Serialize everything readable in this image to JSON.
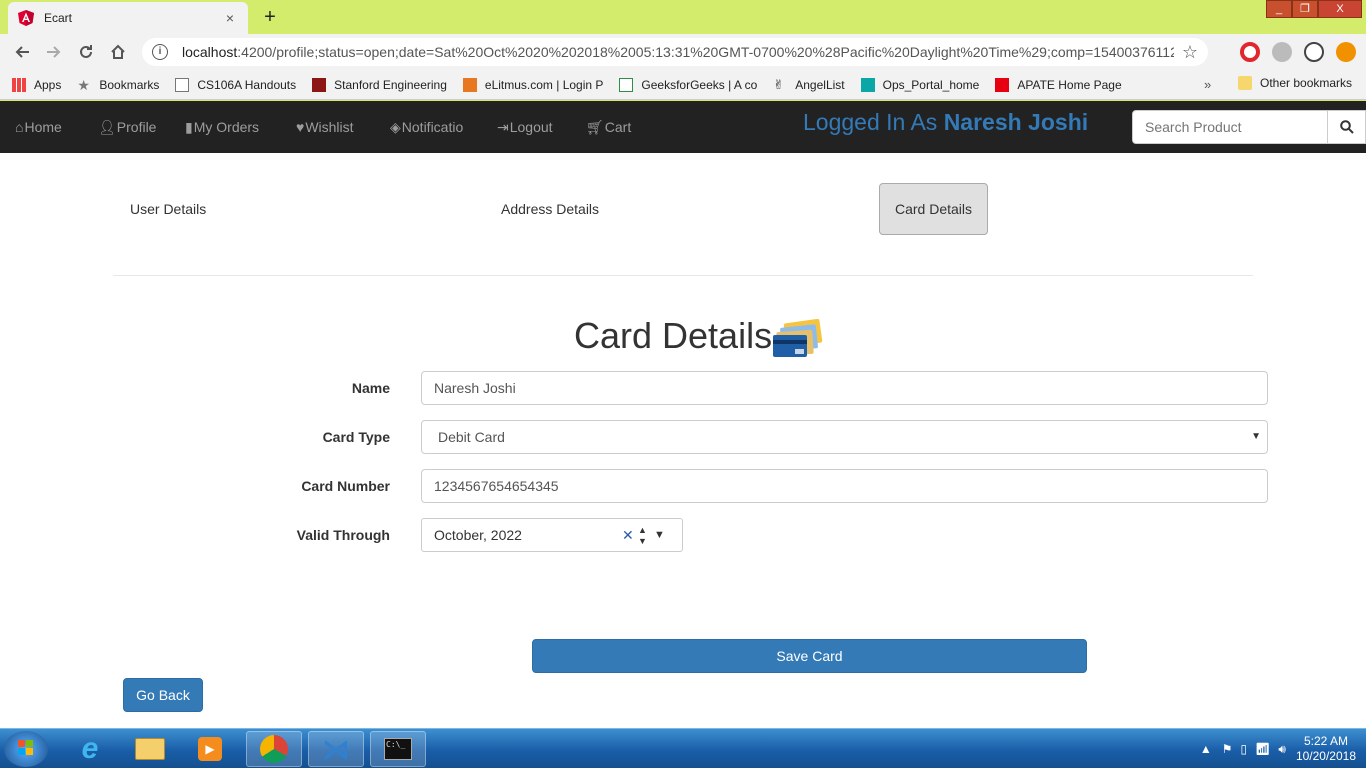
{
  "browser": {
    "tab_title": "Ecart",
    "tab_close": "×",
    "new_tab": "+",
    "url_host": "localhost",
    "url_rest": ":4200/profile;status=open;date=Sat%20Oct%2020%202018%2005:13:31%20GMT-0700%20%28Pacific%20Daylight%20Time%29;comp=154003761126...",
    "window_buttons": [
      "_",
      "❐",
      "X"
    ]
  },
  "bookmarks": {
    "items": [
      "Apps",
      "Bookmarks",
      "CS106A Handouts",
      "Stanford Engineering",
      "eLitmus.com | Login P",
      "GeeksforGeeks | A co",
      "AngelList",
      "Ops_Portal_home",
      "APATE Home Page"
    ],
    "more": "»",
    "other": "Other bookmarks"
  },
  "nav": {
    "home": "Home",
    "profile": "Profile",
    "orders": "My Orders",
    "wishlist": "Wishlist",
    "notifications": "Notificatio",
    "logout": "Logout",
    "cart": "Cart",
    "logged_prefix": "Logged In As ",
    "user_name": "Naresh Joshi",
    "search_placeholder": "Search Product"
  },
  "tabs": {
    "user": "User Details",
    "address": "Address Details",
    "card": "Card Details"
  },
  "form": {
    "heading": "Card Details",
    "name_label": "Name",
    "name_value": "Naresh Joshi",
    "type_label": "Card Type",
    "type_value": "Debit Card",
    "number_label": "Card Number",
    "number_value": "1234567654654345",
    "valid_label": "Valid Through",
    "valid_value": "October, 2022",
    "save": "Save Card",
    "back": "Go Back"
  },
  "taskbar": {
    "time": "5:22 AM",
    "date": "10/20/2018"
  },
  "colors": {
    "browser_frame": "#d4ec6c",
    "navbar": "#222222",
    "primary": "#337ab7"
  }
}
